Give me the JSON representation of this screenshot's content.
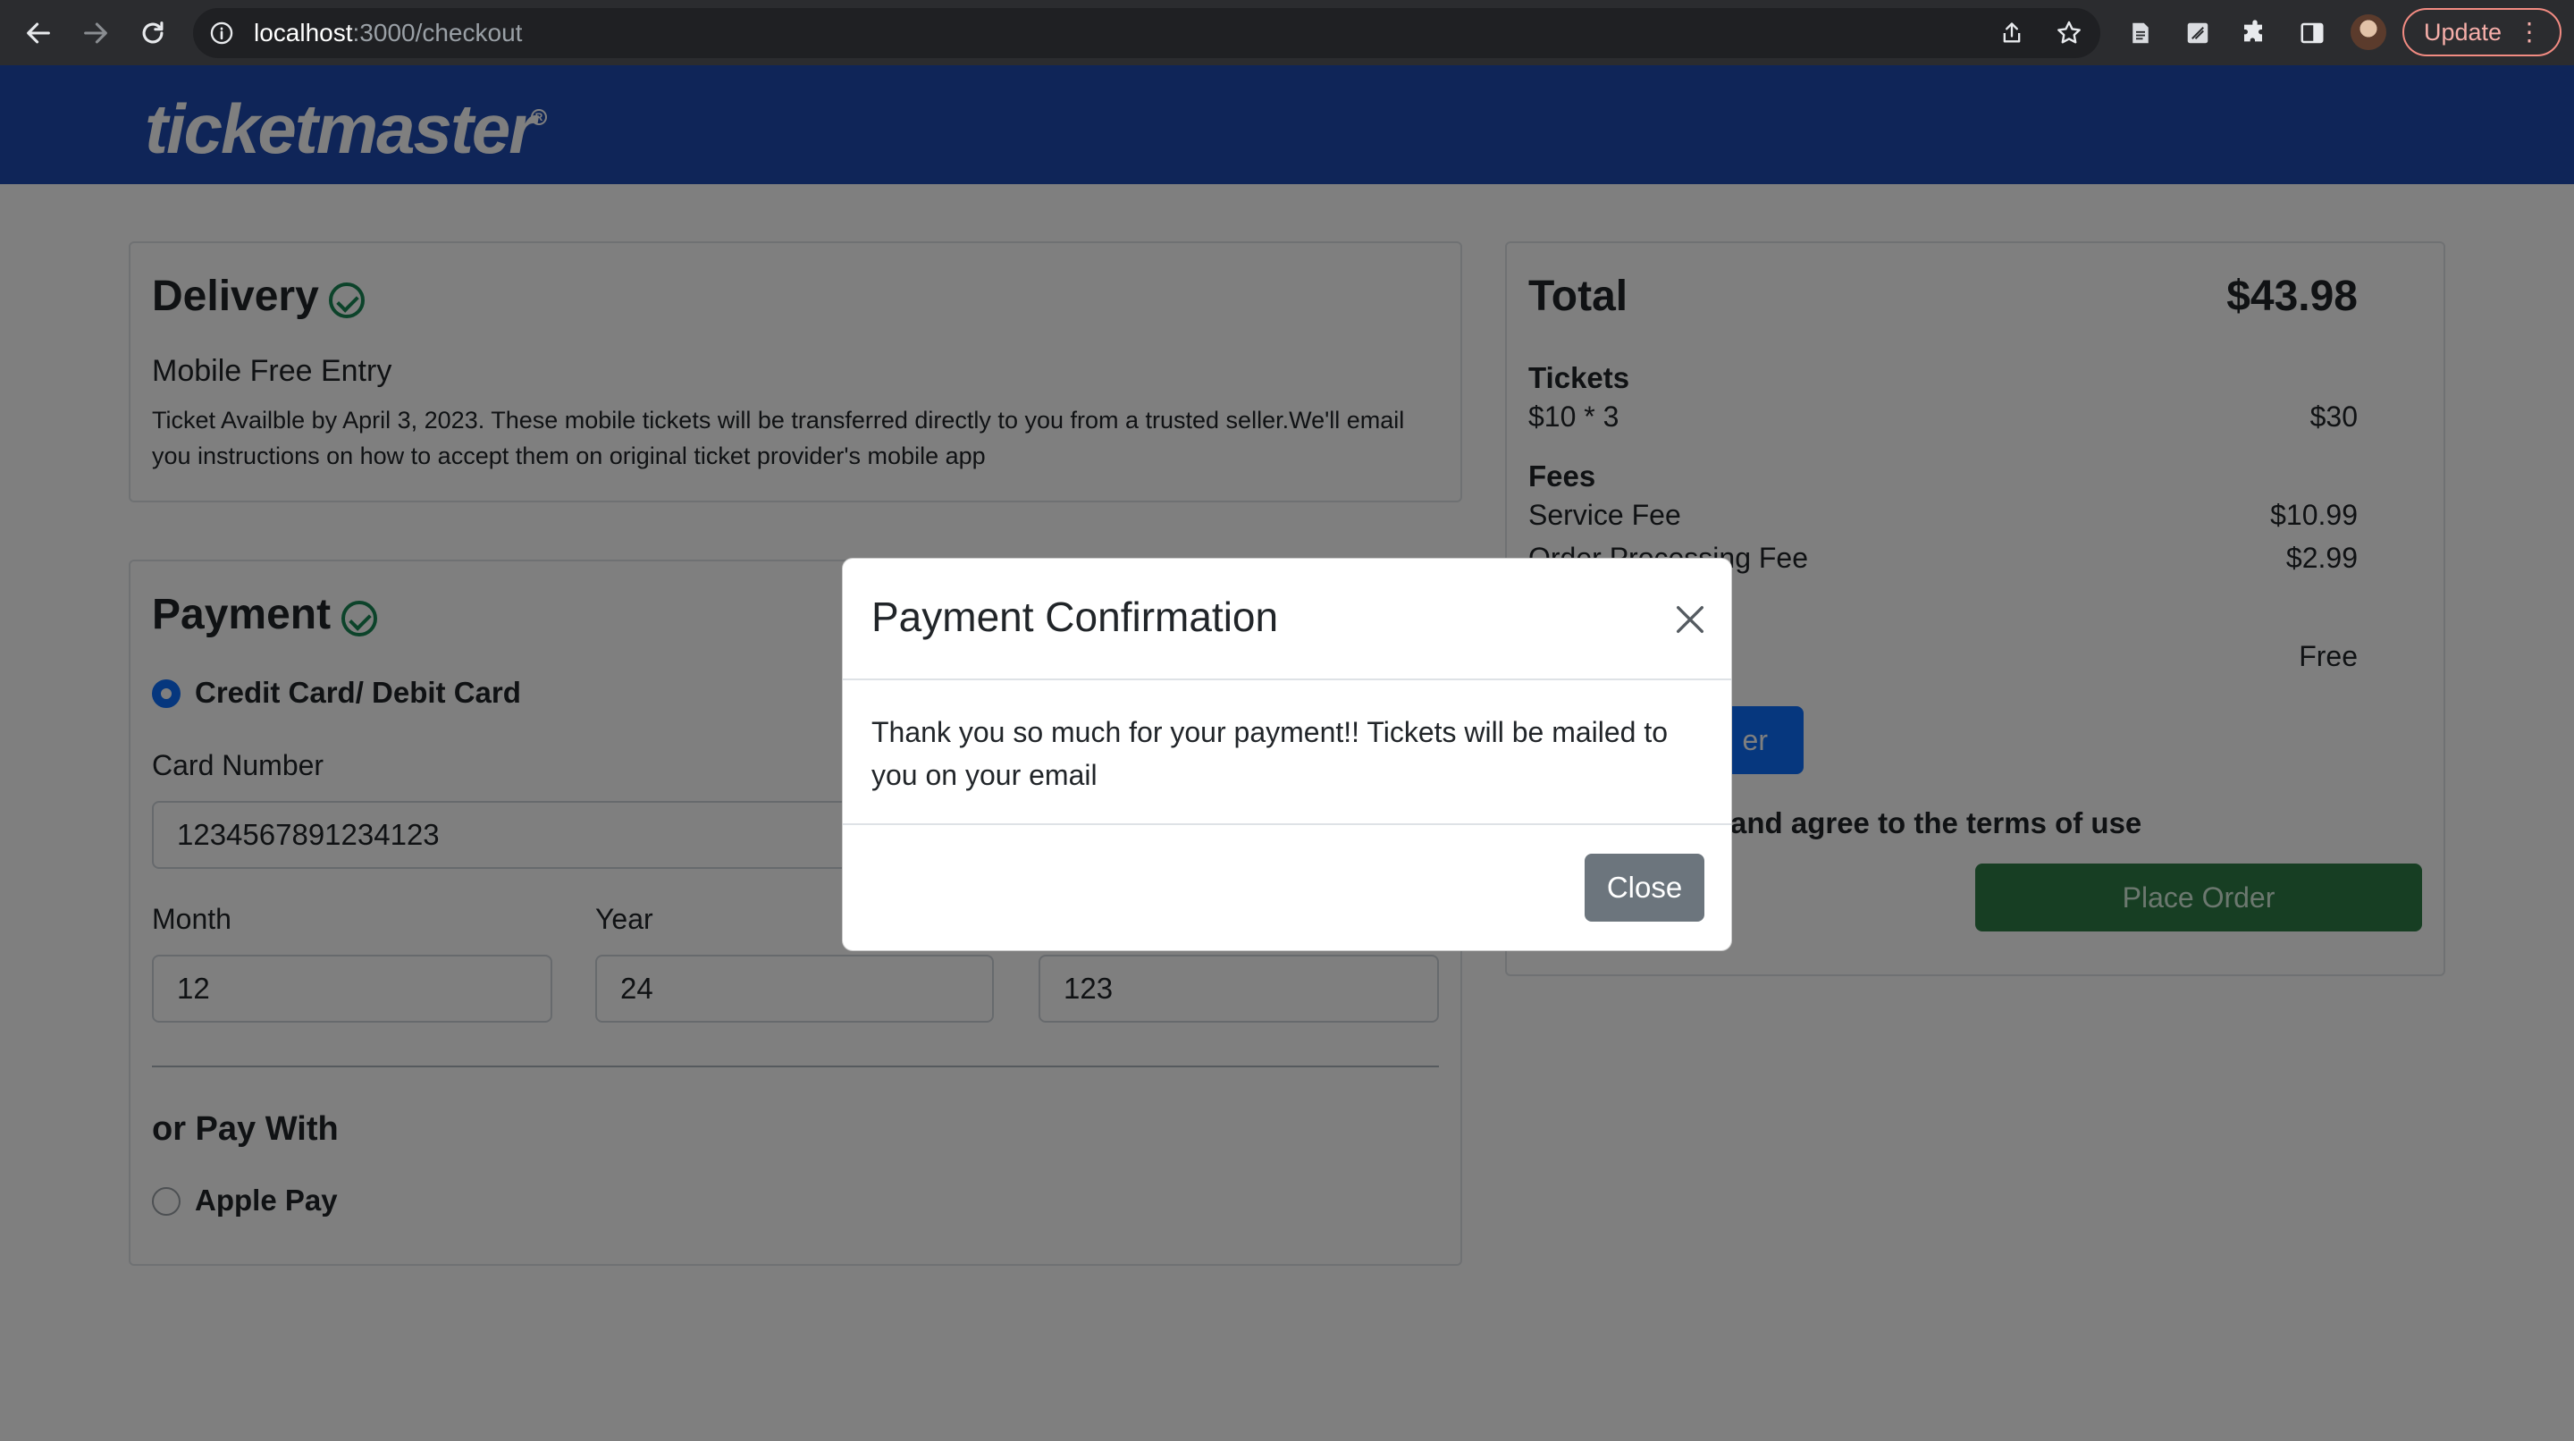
{
  "browser": {
    "url_host": "localhost",
    "url_path": ":3000/checkout",
    "update_label": "Update"
  },
  "site": {
    "logo_text": "ticketmaster"
  },
  "delivery": {
    "heading": "Delivery",
    "method": "Mobile Free Entry",
    "description": "Ticket Availble by April 3, 2023. These mobile tickets will be transferred directly to you from a trusted seller.We'll email you instructions on how to accept them on original ticket provider's mobile app"
  },
  "payment": {
    "heading": "Payment",
    "card_option_label": "Credit Card/ Debit Card",
    "card_number_label": "Card Number",
    "card_number_value": "1234567891234123",
    "month_label": "Month",
    "month_value": "12",
    "year_label": "Year",
    "year_value": "24",
    "cvv_value": "123",
    "alt_heading": "or Pay With",
    "apple_pay_label": "Apple Pay"
  },
  "summary": {
    "total_label": "Total",
    "total_value": "$43.98",
    "tickets_label": "Tickets",
    "tickets_line": "$10 * 3",
    "tickets_amount": "$30",
    "fees_label": "Fees",
    "service_fee_label": "Service Fee",
    "service_fee_value": "$10.99",
    "processing_fee_label": "Order Processing Fee",
    "processing_fee_value": "$2.99",
    "delivery_value": "Free",
    "blue_button_partial": "er",
    "terms_text": "and agree to the terms of use",
    "place_order_label": "Place Order"
  },
  "modal": {
    "title": "Payment Confirmation",
    "body": "Thank you so much for your payment!! Tickets will be mailed to you on your email",
    "close_label": "Close"
  }
}
